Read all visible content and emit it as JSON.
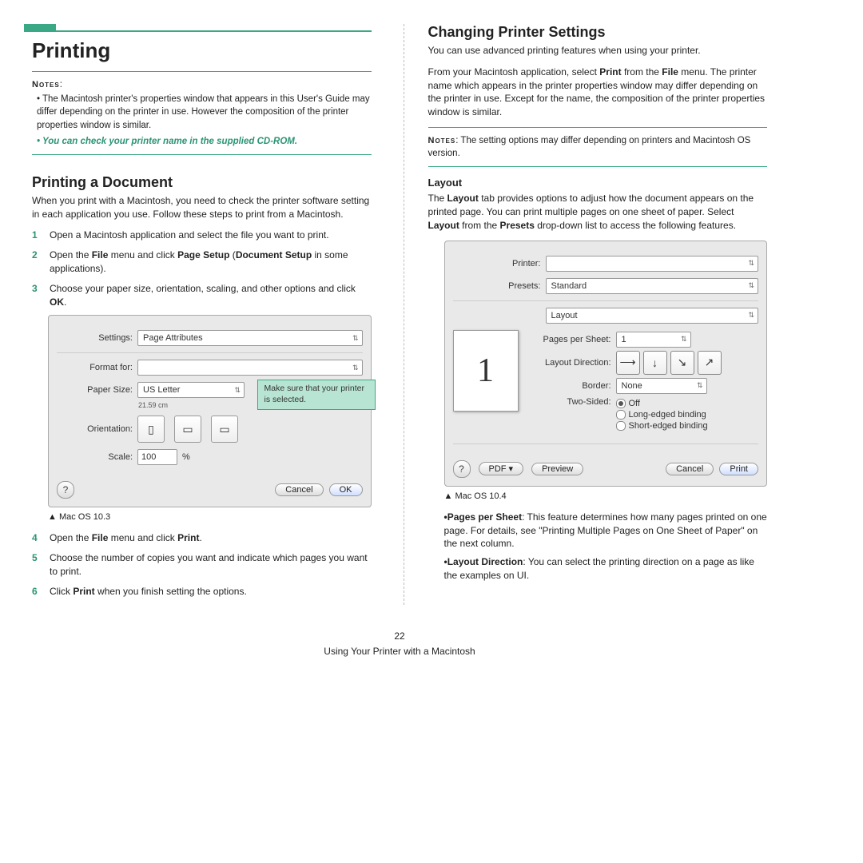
{
  "left": {
    "title": "Printing",
    "notes_label": "Notes",
    "notes": [
      "The Macintosh printer's properties window that appears in this User's Guide may differ depending on the printer in use. However the composition of the printer properties window is similar."
    ],
    "notes_italic": "You can check your printer name in the supplied CD-ROM.",
    "section_title": "Printing a Document",
    "section_intro": "When you print with a Macintosh, you need to check the printer software setting in each application you use. Follow these steps to print from a Macintosh.",
    "steps_before": [
      "Open a Macintosh application and select the file you want to print.",
      "Open the <b>File</b> menu and click <b>Page Setup</b> (<b>Document Setup</b> in some applications).",
      "Choose your paper size, orientation, scaling, and other options and click <b>OK</b>."
    ],
    "dialog": {
      "settings_lbl": "Settings:",
      "settings_val": "Page Attributes",
      "format_lbl": "Format for:",
      "format_val": "",
      "paper_lbl": "Paper Size:",
      "paper_val": "US Letter",
      "paper_sub": "21.59 cm",
      "orient_lbl": "Orientation:",
      "scale_lbl": "Scale:",
      "scale_val": "100",
      "scale_suffix": "%",
      "cancel": "Cancel",
      "ok": "OK",
      "callout": "Make sure that your printer is selected."
    },
    "caption1": "Mac OS 10.3",
    "steps_after": [
      "Open the <b>File</b> menu and click <b>Print</b>.",
      "Choose the number of copies you want and indicate which pages you want to print.",
      "Click <b>Print</b> when you finish setting the options."
    ]
  },
  "right": {
    "title": "Changing Printer Settings",
    "p1": "You can use advanced printing features when using your printer.",
    "p2": "From your Macintosh application, select <b>Print</b> from the <b>File</b> menu. The printer name which appears in the printer properties window may differ depending on the printer in use. Except for the name, the composition of the printer properties window is similar.",
    "notes_label": "Notes",
    "notes_text": ": The setting options may differ depending on printers and Macintosh OS version.",
    "layout_heading": "Layout",
    "layout_intro": "The <b>Layout</b> tab provides options to adjust how the document appears on the printed page. You can print multiple pages on one sheet of paper. Select <b>Layout</b> from the <b>Presets</b> drop-down list to access the following features.",
    "dialog": {
      "printer_lbl": "Printer:",
      "printer_val": "",
      "presets_lbl": "Presets:",
      "presets_val": "Standard",
      "section_val": "Layout",
      "preview_num": "1",
      "pps_lbl": "Pages per Sheet:",
      "pps_val": "1",
      "dir_lbl": "Layout Direction:",
      "border_lbl": "Border:",
      "border_val": "None",
      "two_lbl": "Two-Sided:",
      "two_off": "Off",
      "two_long": "Long-edged binding",
      "two_short": "Short-edged binding",
      "pdf": "PDF ▾",
      "preview": "Preview",
      "cancel": "Cancel",
      "print": "Print"
    },
    "caption2": "Mac OS 10.4",
    "bullets": [
      "<b>Pages per Sheet</b>: This feature determines how many pages printed on one page. For details, see \"Printing Multiple Pages on One Sheet of Paper\" on the next column.",
      "<b>Layout Direction</b>: You can select the printing direction on a page as like the examples on UI."
    ]
  },
  "footer": {
    "page": "22",
    "text": "Using Your Printer with a Macintosh"
  }
}
